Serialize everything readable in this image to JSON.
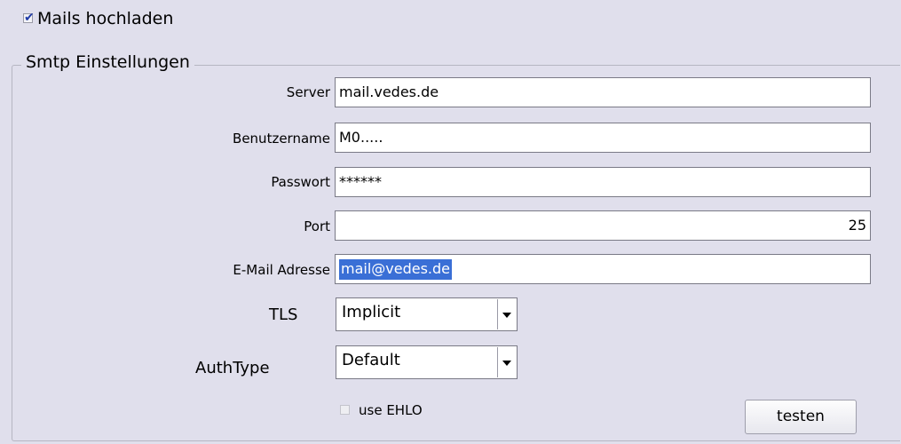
{
  "upload": {
    "checked": true,
    "label": "Mails hochladen"
  },
  "smtp": {
    "title": "Smtp Einstellungen",
    "server": {
      "label": "Server",
      "value": "mail.vedes.de"
    },
    "username": {
      "label": "Benutzername",
      "value": "M0....."
    },
    "password": {
      "label": "Passwort",
      "value": "******"
    },
    "port": {
      "label": "Port",
      "value": "25"
    },
    "email": {
      "label": "E-Mail Adresse",
      "value": "mail@vedes.de"
    },
    "tls": {
      "label": "TLS",
      "value": "Implicit"
    },
    "authtype": {
      "label": "AuthType",
      "value": "Default"
    },
    "ehlo": {
      "label": "use EHLO",
      "checked": false
    },
    "test_button": "testen"
  },
  "icons": {
    "checkmark": "check-icon",
    "dropdown": "chevron-down-icon"
  },
  "colors": {
    "background": "#e0dfec",
    "selection": "#3a6fd6",
    "checkmark": "#1f3aa8"
  }
}
